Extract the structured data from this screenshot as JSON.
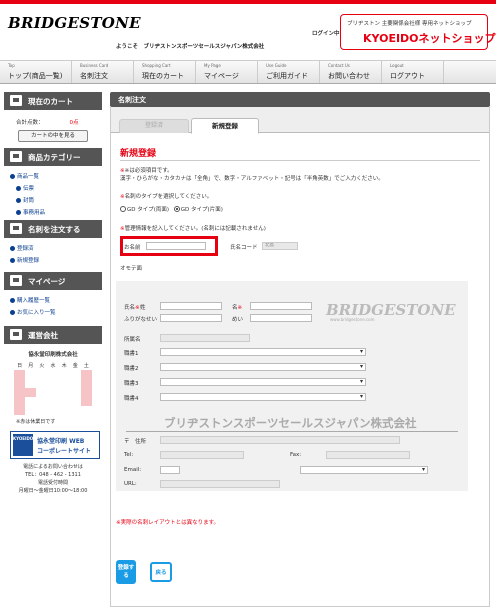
{
  "header": {
    "logo": "BRIDGESTONE",
    "login": "ログイン中",
    "welcome": "ようこそ　ブリヂストンスポーツセールスジャパン株式会社",
    "shop_sub": "ブリヂストン 主要関係会社様 専用ネットショップ",
    "shop_main": "KYOEIDOネットショップ"
  },
  "nav": [
    {
      "en": "Top",
      "jp": "トップ(商品一覧)"
    },
    {
      "en": "Business Card",
      "jp": "名刺注文"
    },
    {
      "en": "Shopping Cart",
      "jp": "現在のカート"
    },
    {
      "en": "My Page",
      "jp": "マイページ"
    },
    {
      "en": "Use Guide",
      "jp": "ご利用ガイド"
    },
    {
      "en": "Contact Us",
      "jp": "お問い合わせ"
    },
    {
      "en": "Logout",
      "jp": "ログアウト"
    }
  ],
  "sidebar": {
    "cart_title": "現在のカート",
    "cart_total_label": "合計点数：",
    "cart_total_value": "0点",
    "cart_button": "カートの中を見る",
    "category_title": "商品カテゴリー",
    "categories": [
      "商品一覧",
      "伝票",
      "封筒",
      "事務用品"
    ],
    "order_title": "名刺を注文する",
    "order_links": [
      "登録済",
      "新規登録"
    ],
    "mypage_title": "マイページ",
    "mypage_links": [
      "購入履歴一覧",
      "お気に入り一覧"
    ],
    "company_title": "運営会社",
    "company_name": "協永堂印刷株式会社",
    "cal_head": [
      "日",
      "月",
      "火",
      "水",
      "木",
      "金",
      "土"
    ],
    "cal_note": "※赤は休業日です",
    "banner_left": "KYOEIDO",
    "banner_t1": "協永堂印刷 WEB",
    "banner_t2": "コーポレートサイト",
    "contact1": "電話によるお問い合わせは",
    "contact2": "TEL：048 - 462 - 1311",
    "contact3": "電話受付時間",
    "contact4": "月曜日〜金曜日10:00〜18:00"
  },
  "main": {
    "heading": "名刺注文",
    "tab_registered": "登録済",
    "tab_new": "新規登録",
    "form_title": "新規登録",
    "req_note1": "※は必須項目です。",
    "req_note2": "漢字・ひらがな・カタカナは「全角」で、数字・アルファベット・記号は「半角英数」でご入力ください。",
    "type_prompt": "名刺のタイプを選択してください。",
    "type_options": [
      "GD タイプ(両面)",
      "GD タイプ(片面)"
    ],
    "manager_prompt": "管理情報を記入してください。(名刺には記載されません)",
    "name_label": "お名前",
    "shop_code_label": "氏名コード",
    "shop_code_value": "北島",
    "ocr_label": "オモテ面",
    "card": {
      "watermark_logo": "BRIDGESTONE",
      "watermark_url": "www.bridgestone.com",
      "company_name": "ブリヂストンスポーツセールスジャパン株式会社",
      "last_label": "氏名",
      "sei_label": "姓",
      "mei_label": "名",
      "furigana_label": "ふりがな",
      "sei2_label": "せい",
      "mei2_label": "めい",
      "dept_label": "所属名",
      "title_labels": [
        "職書1",
        "職書2",
        "職書3",
        "職書4"
      ],
      "address_label": "〒　住所",
      "tel_label": "Tel:",
      "fax_label": "Fax:",
      "email_label": "Email:",
      "url_label": "URL:"
    },
    "layout_note": "※実際の名刺レイアウトとは異なります。",
    "submit_label": "登録する",
    "back_label": "戻る"
  }
}
